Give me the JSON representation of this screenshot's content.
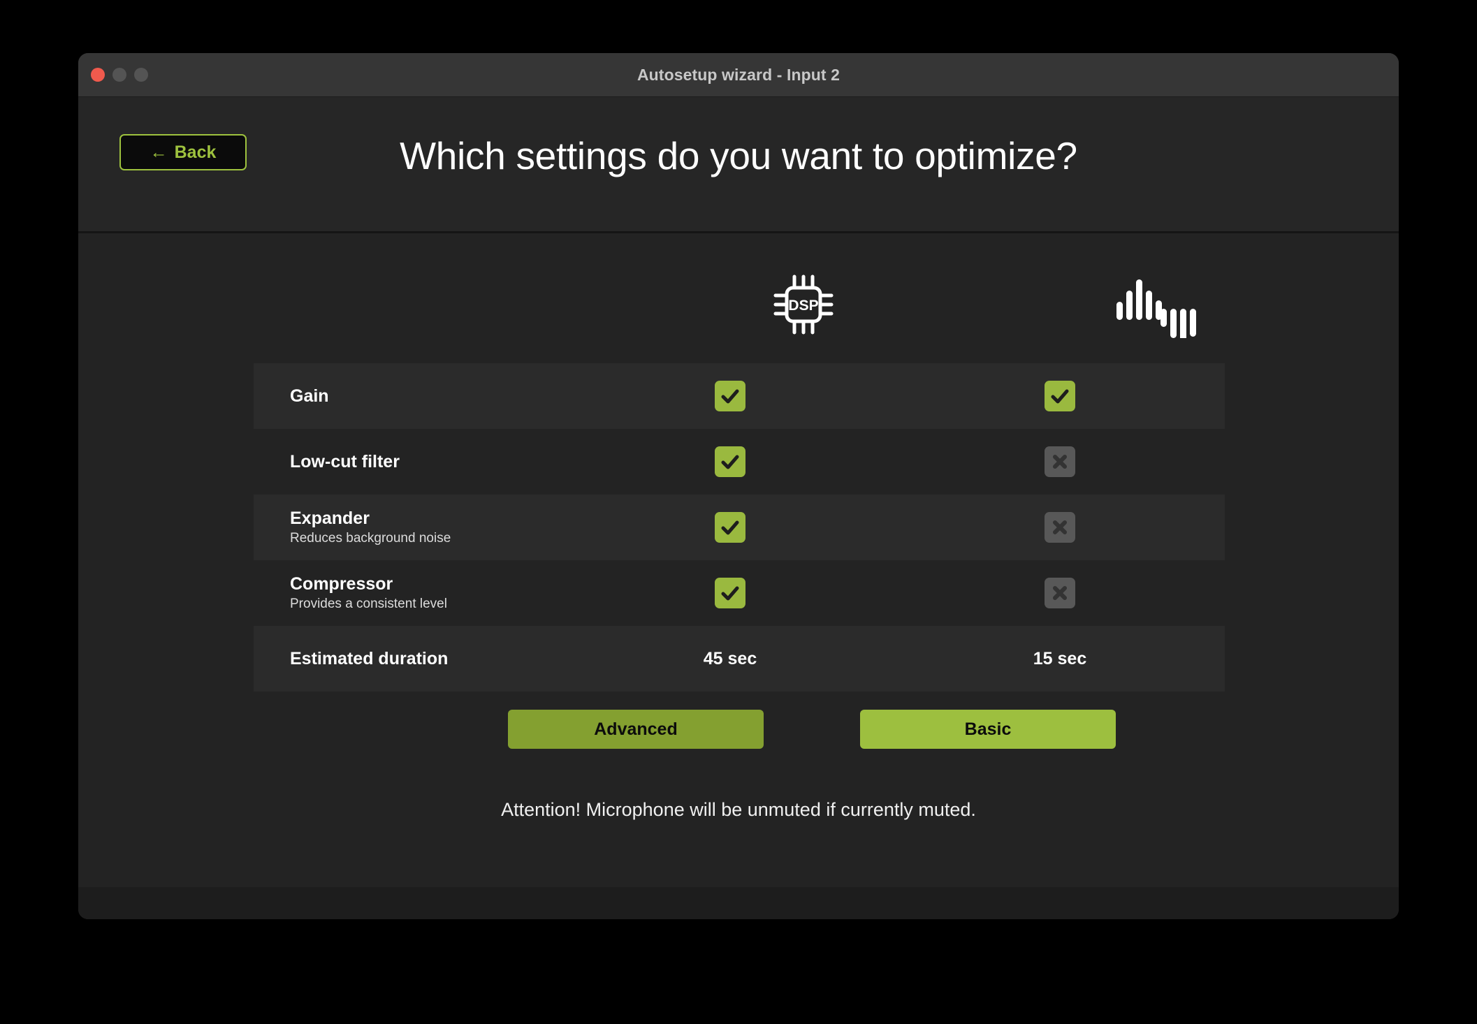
{
  "window": {
    "title": "Autosetup wizard - Input 2",
    "traffic_lights": [
      "close",
      "minimize",
      "maximize"
    ]
  },
  "header": {
    "back_label": "Back",
    "back_arrow": "←",
    "page_title": "Which settings do you want to optimize?"
  },
  "columns": [
    {
      "key": "advanced",
      "icon": "dsp-chip-icon",
      "icon_label": "DSP"
    },
    {
      "key": "basic",
      "icon": "audio-waveform-icon",
      "icon_label": ""
    }
  ],
  "table": {
    "rows": [
      {
        "label": "Gain",
        "sublabel": "",
        "advanced": "check",
        "basic": "check"
      },
      {
        "label": "Low-cut filter",
        "sublabel": "",
        "advanced": "check",
        "basic": "cross"
      },
      {
        "label": "Expander",
        "sublabel": "Reduces background noise",
        "advanced": "check",
        "basic": "cross"
      },
      {
        "label": "Compressor",
        "sublabel": "Provides a consistent level",
        "advanced": "check",
        "basic": "cross"
      }
    ],
    "duration_row": {
      "label": "Estimated duration",
      "advanced": "45 sec",
      "basic": "15 sec"
    }
  },
  "actions": {
    "advanced_label": "Advanced",
    "basic_label": "Basic"
  },
  "notice": {
    "attention": "Attention! Microphone will be unmuted if currently muted."
  },
  "colors": {
    "accent_green": "#9ab93f",
    "accent_green_dark": "#84a030",
    "back_outline": "#9ec23e",
    "disabled_gray": "#585858",
    "window_bg": "#232323",
    "row_alt_bg": "#2b2b2b",
    "titlebar_bg": "#363636",
    "close_red": "#f05a4d"
  }
}
